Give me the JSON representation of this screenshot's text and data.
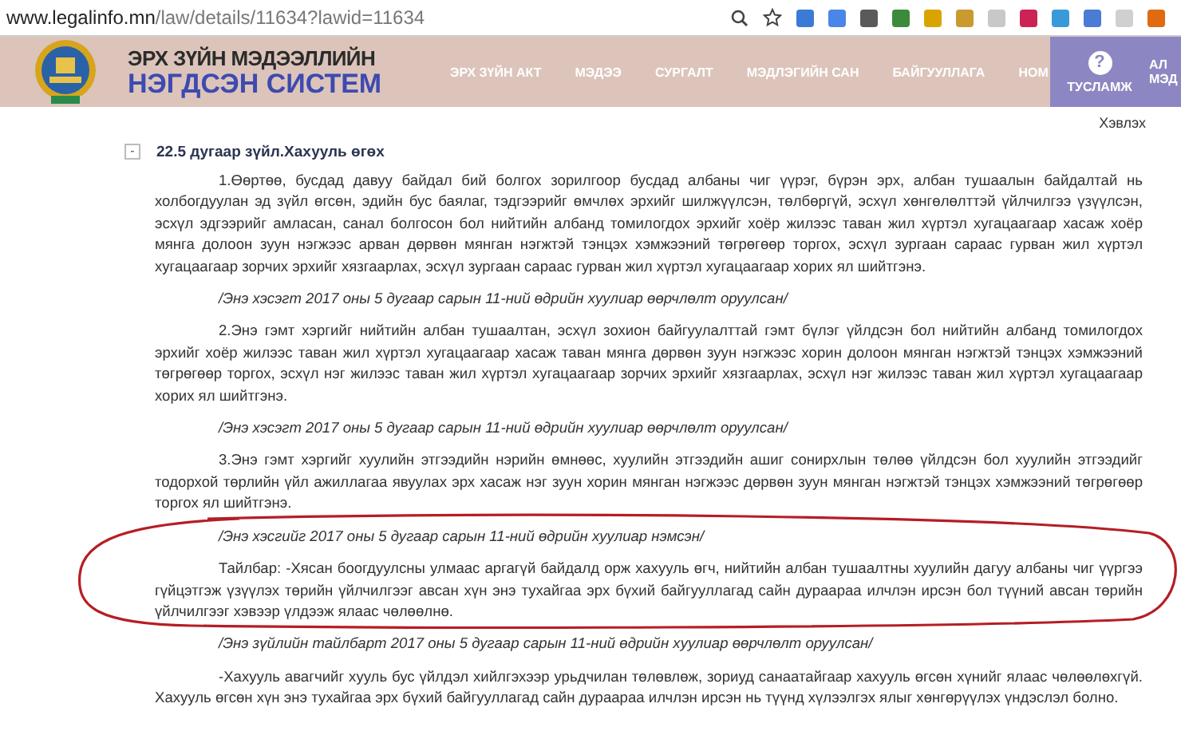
{
  "browser": {
    "url_host": "www.legalinfo.mn",
    "url_path": "/law/details/11634?lawid=11634"
  },
  "header": {
    "title_line_1": "ЭРХ ЗҮЙН МЭДЭЭЛЛИЙН",
    "title_line_2": "НЭГДСЭН СИСТЕМ",
    "nav": [
      "ЭРХ ЗҮЙН АКТ",
      "МЭДЭЭ",
      "СУРГАЛТ",
      "МЭДЛЭГИЙН САН",
      "БАЙГУУЛЛАГА",
      "НОМ"
    ],
    "help": {
      "icon": "?",
      "label": "ТУСЛАМЖ"
    },
    "extra": {
      "line_1": "АЛ",
      "line_2": "МЭД"
    }
  },
  "print_link": "Хэвлэх",
  "article": {
    "toggle": "-",
    "title": "22.5 дугаар зүйл.Хахууль өгөх",
    "blocks": [
      {
        "kind": "paragraph",
        "text": "1.Өөртөө, бусдад давуу байдал бий болгох зорилгоор бусдад албаны чиг үүрэг, бүрэн эрх, албан тушаалын байдалтай нь холбогдуулан эд зүйл өгсөн, эдийн бус баялаг, тэдгээрийг өмчлөх эрхийг шилжүүлсэн, төлбөргүй, эсхүл хөнгөлөлттэй үйлчилгээ үзүүлсэн, эсхүл эдгээрийг амласан, санал болгосон бол нийтийн албанд томилогдох эрхийг хоёр жилээс таван жил хүртэл хугацаагаар хасаж хоёр мянга долоон зуун нэгжээс арван дөрвөн мянган нэгжтэй тэнцэх хэмжээний төгрөгөөр торгох, эсхүл зургаан сараас гурван жил хүртэл хугацаагаар зорчих эрхийг хязгаарлах, эсхүл зургаан сараас гурван жил хүртэл хугацаагаар хорих ял шийтгэнэ."
      },
      {
        "kind": "note",
        "text": "/Энэ хэсэгт 2017 оны 5 дугаар сарын 11-ний өдрийн хуулиар өөрчлөлт оруулсан/"
      },
      {
        "kind": "paragraph",
        "text": "2.Энэ гэмт хэргийг нийтийн албан тушаалтан, эсхүл зохион байгуулалттай гэмт бүлэг үйлдсэн бол нийтийн албанд томилогдох эрхийг хоёр жилээс таван жил хүртэл хугацаагаар хасаж таван мянга дөрвөн зуун нэгжээс хорин долоон мянган нэгжтэй тэнцэх хэмжээний төгрөгөөр торгох, эсхүл нэг жилээс таван жил хүртэл хугацаагаар зорчих эрхийг хязгаарлах, эсхүл нэг жилээс таван жил хүртэл хугацаагаар хорих ял шийтгэнэ."
      },
      {
        "kind": "note",
        "text": "/Энэ хэсэгт 2017 оны 5 дугаар сарын 11-ний өдрийн хуулиар өөрчлөлт оруулсан/"
      },
      {
        "kind": "paragraph",
        "text": "3.Энэ гэмт хэргийг хуулийн этгээдийн нэрийн өмнөөс, хуулийн этгээдийн ашиг сонирхлын төлөө үйлдсэн бол хуулийн этгээдийг тодорхой төрлийн үйл ажиллагаа явуулах эрх хасаж нэг зуун хорин мянган нэгжээс дөрвөн зуун мянган нэгжтэй тэнцэх хэмжээний төгрөгөөр торгох ял шийтгэнэ."
      },
      {
        "kind": "note",
        "text": "/Энэ хэсгийг 2017 оны 5 дугаар сарын 11-ний өдрийн хуулиар нэмсэн/"
      },
      {
        "kind": "paragraph",
        "text": "Тайлбар: -Хясан боогдуулсны улмаас аргагүй байдалд орж хахууль өгч, нийтийн албан тушаалтны хуулийн дагуу албаны чиг үүргээ гүйцэтгэж үзүүлэх төрийн үйлчилгээг авсан хүн энэ тухайгаа эрх бүхий байгууллагад сайн дураараа илчлэн ирсэн бол түүний авсан төрийн үйлчилгээг хэвээр үлдээж ялаас чөлөөлнө."
      },
      {
        "kind": "note",
        "text": "/Энэ зүйлийн тайлбарт 2017 оны 5 дугаар сарын 11-ний өдрийн хуулиар өөрчлөлт оруулсан/"
      },
      {
        "kind": "paragraph",
        "text": "-Хахууль авагчийг хууль бус үйлдэл хийлгэхээр урьдчилан төлөвлөж, зориуд санаатайгаар хахууль өгсөн хүнийг ялаас чөлөөлөхгүй. Хахууль өгсөн хүн энэ тухайгаа эрх бүхий байгууллагад сайн дураараа илчлэн ирсэн нь түүнд хүлээлгэх ялыг хөнгөрүүлэх үндэслэл болно."
      }
    ]
  }
}
